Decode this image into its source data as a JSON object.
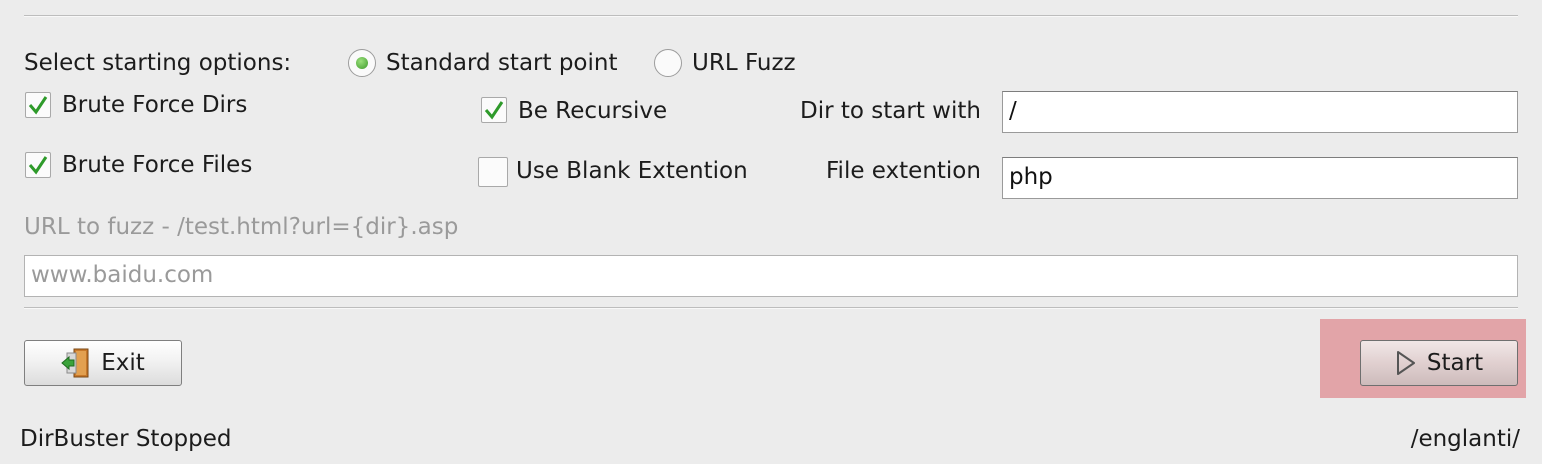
{
  "options": {
    "label": "Select starting options:",
    "radios": [
      {
        "label": "Standard start point",
        "selected": true
      },
      {
        "label": "URL Fuzz",
        "selected": false
      }
    ]
  },
  "checkboxes": {
    "brute_force_dirs": {
      "label": "Brute Force Dirs",
      "checked": true
    },
    "brute_force_files": {
      "label": "Brute Force Files",
      "checked": true
    },
    "be_recursive": {
      "label": "Be Recursive",
      "checked": true
    },
    "use_blank_extension": {
      "label": "Use Blank Extention",
      "checked": false
    }
  },
  "fields": {
    "dir_to_start": {
      "label": "Dir to start with",
      "value": "/"
    },
    "file_extension": {
      "label": "File extention",
      "value": "php"
    },
    "url_fuzz": {
      "label": "URL to fuzz - /test.html?url={dir}.asp",
      "value": "www.baidu.com"
    }
  },
  "buttons": {
    "exit": {
      "label": "Exit",
      "icon": "exit-door-icon"
    },
    "start": {
      "label": "Start",
      "icon": "play-icon"
    }
  },
  "status": {
    "left": "DirBuster Stopped",
    "right": "/englanti/"
  },
  "colors": {
    "check_green": "#2e9a2a",
    "highlight": "#e2a4a8",
    "disabled_text": "#9a9a9a"
  }
}
